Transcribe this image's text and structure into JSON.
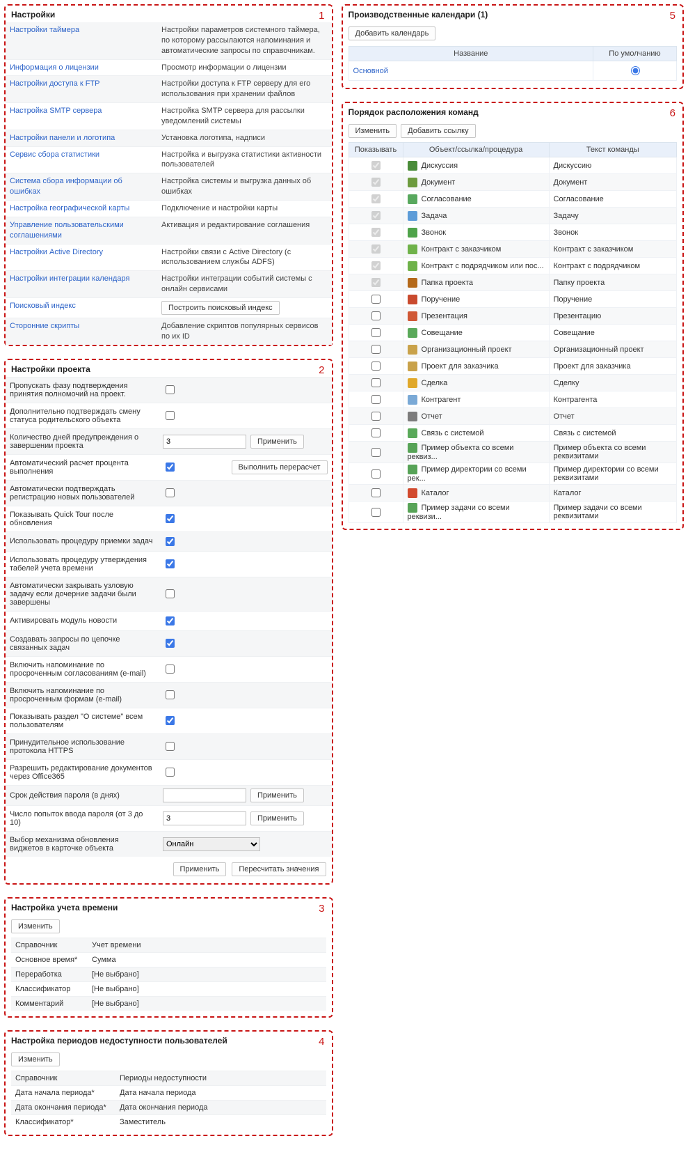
{
  "panels": {
    "settings_title": "Настройки",
    "project_title": "Настройки проекта",
    "time_title": "Настройка учета времени",
    "unavail_title": "Настройка периодов недоступности пользователей",
    "calendars_title": "Производственные календари (1)",
    "commands_title": "Порядок расположения команд"
  },
  "common": {
    "apply": "Применить",
    "recalc": "Пересчитать значения",
    "edit": "Изменить",
    "add_link": "Добавить ссылку",
    "add_calendar": "Добавить календарь",
    "recalc_exec": "Выполнить перерасчет",
    "build_index": "Построить поисковый индекс"
  },
  "settings": [
    {
      "k": "Настройки таймера",
      "v": "Настройки параметров системного таймера, по которому рассылаются напоминания и автоматические запросы по справочникам."
    },
    {
      "k": "Информация о лицензии",
      "v": "Просмотр информации о лицензии"
    },
    {
      "k": "Настройки доступа к FTP",
      "v": "Настройки доступа к FTP серверу для его использования при хранении файлов"
    },
    {
      "k": "Настройка SMTP сервера",
      "v": "Настройка SMTP сервера для рассылки уведомлений системы"
    },
    {
      "k": "Настройки панели и логотипа",
      "v": "Установка логотипа, надписи"
    },
    {
      "k": "Сервис сбора статистики",
      "v": "Настройка и выгрузка статистики активности пользователей"
    },
    {
      "k": "Система сбора информации об ошибках",
      "v": "Настройка системы и выгрузка данных об ошибках"
    },
    {
      "k": "Настройка географической карты",
      "v": "Подключение и настройки карты"
    },
    {
      "k": "Управление пользовательскими соглашениями",
      "v": "Активация и редактирование соглашения"
    },
    {
      "k": "Настройки Active Directory",
      "v": "Настройки связи с Active Directory (с использованием службы ADFS)"
    },
    {
      "k": "Настройки интеграции календаря",
      "v": "Настройки интеграции событий системы с онлайн сервисами"
    },
    {
      "k": "Поисковый индекс",
      "v": "__button_index"
    },
    {
      "k": "Сторонние скрипты",
      "v": "Добавление скриптов популярных сервисов по их ID"
    }
  ],
  "project": [
    {
      "label": "Пропускать фазу подтверждения принятия полномочий на проект.",
      "type": "checkbox",
      "checked": false
    },
    {
      "label": "Дополнительно подтверждать смену статуса родительского объекта",
      "type": "checkbox",
      "checked": false
    },
    {
      "label": "Количество дней предупреждения о завершении проекта",
      "type": "text_apply",
      "value": "3"
    },
    {
      "label": "Автоматический расчет процента выполнения",
      "type": "check_btn",
      "checked": true
    },
    {
      "label": "Автоматически подтверждать регистрацию новых пользователей",
      "type": "checkbox",
      "checked": false
    },
    {
      "label": "Показывать Quick Tour после обновления",
      "type": "checkbox",
      "checked": true
    },
    {
      "label": "Использовать процедуру приемки задач",
      "type": "checkbox",
      "checked": true
    },
    {
      "label": "Использовать процедуру утверждения табелей учета времени",
      "type": "checkbox",
      "checked": true
    },
    {
      "label": "Автоматически закрывать узловую задачу если дочерние задачи были завершены",
      "type": "checkbox",
      "checked": false
    },
    {
      "label": "Активировать модуль новости",
      "type": "checkbox",
      "checked": true
    },
    {
      "label": "Создавать запросы по цепочке связанных задач",
      "type": "checkbox",
      "checked": true
    },
    {
      "label": "Включить напоминание по просроченным согласованиям (e-mail)",
      "type": "checkbox",
      "checked": false
    },
    {
      "label": "Включить напоминание по просроченным формам (e-mail)",
      "type": "checkbox",
      "checked": false
    },
    {
      "label": "Показывать раздел \"О системе\" всем пользователям",
      "type": "checkbox",
      "checked": true
    },
    {
      "label": "Принудительное использование протокола HTTPS",
      "type": "checkbox",
      "checked": false
    },
    {
      "label": "Разрешить редактирование документов через Office365",
      "type": "checkbox",
      "checked": false
    },
    {
      "label": "Срок действия пароля (в днях)",
      "type": "text_apply",
      "value": ""
    },
    {
      "label": "Число попыток ввода пароля (от 3 до 10)",
      "type": "text_apply",
      "value": "3"
    },
    {
      "label": "Выбор механизма обновления виджетов в карточке объекта",
      "type": "select",
      "value": "Онлайн"
    }
  ],
  "time": [
    {
      "k": "Справочник",
      "v": "Учет времени"
    },
    {
      "k": "Основное время*",
      "v": "Сумма"
    },
    {
      "k": "Переработка",
      "v": "[Не выбрано]"
    },
    {
      "k": "Классификатор",
      "v": "[Не выбрано]"
    },
    {
      "k": "Комментарий",
      "v": "[Не выбрано]"
    }
  ],
  "unavail": [
    {
      "k": "Справочник",
      "v": "Периоды недоступности"
    },
    {
      "k": "Дата начала периода*",
      "v": "Дата начала периода"
    },
    {
      "k": "Дата окончания периода*",
      "v": "Дата окончания периода"
    },
    {
      "k": "Классификатор*",
      "v": "Заместитель"
    }
  ],
  "calendar": {
    "headers": {
      "name": "Название",
      "default": "По умолчанию"
    },
    "rows": [
      {
        "name": "Основной",
        "default": true
      }
    ]
  },
  "commands": {
    "headers": {
      "show": "Показывать",
      "obj": "Объект/ссылка/процедура",
      "txt": "Текст команды"
    },
    "rows": [
      {
        "show": true,
        "disabled": true,
        "obj": "Дискуссия",
        "txt": "Дискуссию",
        "color": "#4a8c3a"
      },
      {
        "show": true,
        "disabled": true,
        "obj": "Документ",
        "txt": "Документ",
        "color": "#6d9b3e"
      },
      {
        "show": true,
        "disabled": true,
        "obj": "Согласование",
        "txt": "Согласование",
        "color": "#58a85e"
      },
      {
        "show": true,
        "disabled": true,
        "obj": "Задача",
        "txt": "Задачу",
        "color": "#5c9cd8"
      },
      {
        "show": true,
        "disabled": true,
        "obj": "Звонок",
        "txt": "Звонок",
        "color": "#4fa34a"
      },
      {
        "show": true,
        "disabled": true,
        "obj": "Контракт с заказчиком",
        "txt": "Контракт с заказчиком",
        "color": "#6fb24a"
      },
      {
        "show": true,
        "disabled": true,
        "obj": "Контракт с подрядчиком или пос...",
        "txt": "Контракт с подрядчиком",
        "color": "#6fb24a"
      },
      {
        "show": true,
        "disabled": true,
        "obj": "Папка проекта",
        "txt": "Папку проекта",
        "color": "#b4691a"
      },
      {
        "show": false,
        "disabled": false,
        "obj": "Поручение",
        "txt": "Поручение",
        "color": "#c94a2e"
      },
      {
        "show": false,
        "disabled": false,
        "obj": "Презентация",
        "txt": "Презентацию",
        "color": "#d05836"
      },
      {
        "show": false,
        "disabled": false,
        "obj": "Совещание",
        "txt": "Совещание",
        "color": "#5aa95a"
      },
      {
        "show": false,
        "disabled": false,
        "obj": "Организационный проект",
        "txt": "Организационный проект",
        "color": "#c9a24a"
      },
      {
        "show": false,
        "disabled": false,
        "obj": "Проект для заказчика",
        "txt": "Проект для заказчика",
        "color": "#c9a24a"
      },
      {
        "show": false,
        "disabled": false,
        "obj": "Сделка",
        "txt": "Сделку",
        "color": "#e0a82a"
      },
      {
        "show": false,
        "disabled": false,
        "obj": "Контрагент",
        "txt": "Контрагента",
        "color": "#7aa9d6"
      },
      {
        "show": false,
        "disabled": false,
        "obj": "Отчет",
        "txt": "Отчет",
        "color": "#7c7c7c"
      },
      {
        "show": false,
        "disabled": false,
        "obj": "Связь с системой",
        "txt": "Связь с системой",
        "color": "#5aa95a"
      },
      {
        "show": false,
        "disabled": false,
        "obj": "Пример объекта со всеми реквиз...",
        "txt": "Пример объекта со всеми реквизитами",
        "color": "#57a357"
      },
      {
        "show": false,
        "disabled": false,
        "obj": "Пример директории со всеми рек...",
        "txt": "Пример директории со всеми реквизитами",
        "color": "#57a357"
      },
      {
        "show": false,
        "disabled": false,
        "obj": "Каталог",
        "txt": "Каталог",
        "color": "#d24a2e"
      },
      {
        "show": false,
        "disabled": false,
        "obj": "Пример задачи со всеми реквизи...",
        "txt": "Пример задачи со всеми реквизитами",
        "color": "#57a357"
      }
    ]
  }
}
